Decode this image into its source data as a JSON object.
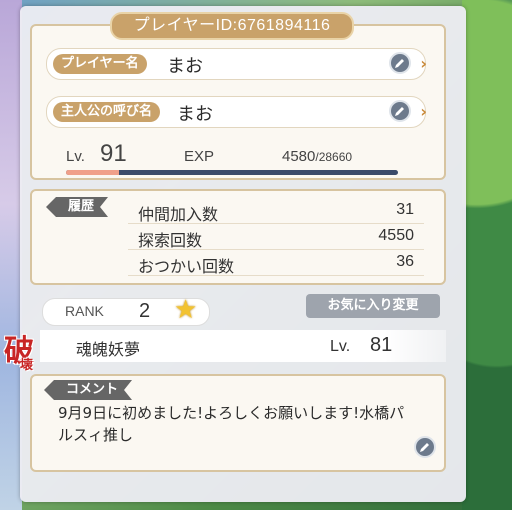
{
  "header": {
    "player_id": "プレイヤーID:6761894116"
  },
  "profile": {
    "player_name_tag": "プレイヤー名",
    "player_name": "まお",
    "hero_name_tag": "主人公の呼び名",
    "hero_name": "まお",
    "level_label": "Lv.",
    "level": "91",
    "exp_label": "EXP",
    "exp_current": "4580",
    "exp_max": "/28660",
    "exp_fraction": 0.16
  },
  "history": {
    "tag": "履歴",
    "rows": [
      {
        "label": "仲間加入数",
        "value": "31"
      },
      {
        "label": "探索回数",
        "value": "4550"
      },
      {
        "label": "おつかい回数",
        "value": "36"
      }
    ]
  },
  "rank": {
    "label": "RANK",
    "value": "2"
  },
  "favorite": {
    "change_button": "お気に入り変更",
    "character_name": "魂魄妖夢",
    "level_label": "Lv.",
    "level": "81",
    "badge_main": "破",
    "badge_sub": "壊"
  },
  "comment": {
    "tag": "コメント",
    "text": "9月9日に初めました!よろしくお願いします!水橋パルスィ推し"
  },
  "colors": {
    "accent": "#c9a26a",
    "badge_red": "#c82525",
    "star": "#f2c230"
  },
  "icons": {
    "edit": "pencil-icon",
    "chevron": "chevron-right-icon",
    "star": "star-icon"
  }
}
